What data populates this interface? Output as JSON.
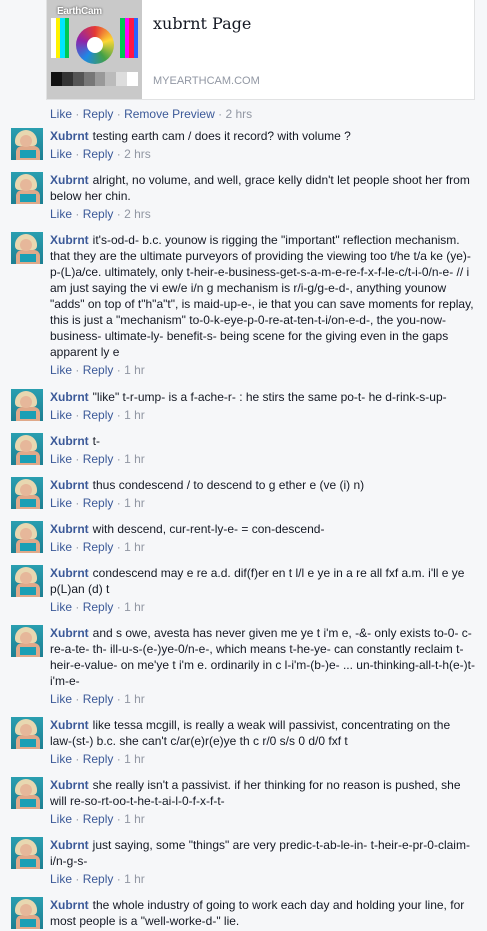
{
  "preview": {
    "title": "xubrnt Page",
    "domain": "MYEARTHCAM.COM",
    "thumb_logo": "EarthCam",
    "colors": {
      "bars": [
        "#ffffff",
        "#fff200",
        "#00e5ff",
        "#00c853",
        "#ff00ff",
        "#ff1744",
        "#2962ff"
      ],
      "grays": [
        "#111111",
        "#333333",
        "#555555",
        "#777777",
        "#999999",
        "#bbbbbb",
        "#dddddd",
        "#ffffff"
      ]
    }
  },
  "post_actions": {
    "like": "Like",
    "reply": "Reply",
    "remove_preview": "Remove Preview",
    "time": "2 hrs"
  },
  "labels": {
    "like": "Like",
    "reply": "Reply",
    "dot": "·"
  },
  "comments": [
    {
      "author": "Xubrnt",
      "text": "testing earth cam / does it record? with volume ?",
      "time": "2 hrs"
    },
    {
      "author": "Xubrnt",
      "text": "alright, no volume, and well, grace kelly didn't let people shoot her from below her chin.",
      "time": "2 hrs"
    },
    {
      "author": "Xubrnt",
      "text": "it's-od-d- b.c. younow is rigging the \"important\" reflection mechanism. that they are the ultimate purveyors of providing the viewing too t/he t/a ke (ye)-p-(L)a/ce. ultimately, only t-heir-e-business-get-s-a-m-e-re-f-x-f-le-c/t-i-0/n-e- // i am just saying the vi ew/e i/n g mechanism is r/i-g/g-e-d-, anything younow \"adds\" on top of t\"h\"a\"t\", is maid-up-e-, ie that you can save moments for replay, this is just a \"mechanism\" to-0-k-eye-p-0-re-at-ten-t-i/on-e-d-, the you-now-business- ultimate-ly- benefit-s- being scene for the giving even in the gaps apparent ly e",
      "time": "1 hr"
    },
    {
      "author": "Xubrnt",
      "text": "\"like\" t-r-ump- is a f-ache-r- : he stirs the same po-t- he d-rink-s-up-",
      "time": "1 hr"
    },
    {
      "author": "Xubrnt",
      "text": "t-",
      "time": "1 hr"
    },
    {
      "author": "Xubrnt",
      "text": "thus condescend / to descend to g ether e (ve (i) n)",
      "time": "1 hr"
    },
    {
      "author": "Xubrnt",
      "text": "with descend, cur-rent-ly-e- = con-descend-",
      "time": "1 hr"
    },
    {
      "author": "Xubrnt",
      "text": "condescend may e re a.d. dif(f)er en t l/l e ye in a re all fxf a.m. i'll e ye p(L)an (d) t",
      "time": "1 hr"
    },
    {
      "author": "Xubrnt",
      "text": "and s owe, avesta has never given me ye t i'm e, -&- only exists to-0- c-re-a-te- th- ill-u-s-(e-)ye-0/n-e-, which means t-he-ye- can constantly reclaim t-heir-e-value- on me'ye t i'm e. ordinarily in c l-i'm-(b-)e- ... un-thinking-all-t-h(e-)t-i'm-e-",
      "time": "1 hr"
    },
    {
      "author": "Xubrnt",
      "text": "like tessa mcgill, is really a weak will passivist, concentrating on the law-(st-) b.c. she can't c/ar(e)r(e)ye th c r/0 s/s 0 d/0 fxf t",
      "time": "1 hr"
    },
    {
      "author": "Xubrnt",
      "text": "she really isn't a passivist. if her thinking for no reason is pushed, she will re-so-rt-oo-t-he-t-ai-l-0-f-x-f-t-",
      "time": "1 hr"
    },
    {
      "author": "Xubrnt",
      "text": "just saying, some \"things\" are very predic-t-ab-le-in- t-heir-e-pr-0-claim-i/n-g-s-",
      "time": "1 hr"
    },
    {
      "author": "Xubrnt",
      "text": "the whole industry of going to work each day and holding your line, for most people is a \"well-worke-d-\" lie.",
      "time": ""
    }
  ]
}
